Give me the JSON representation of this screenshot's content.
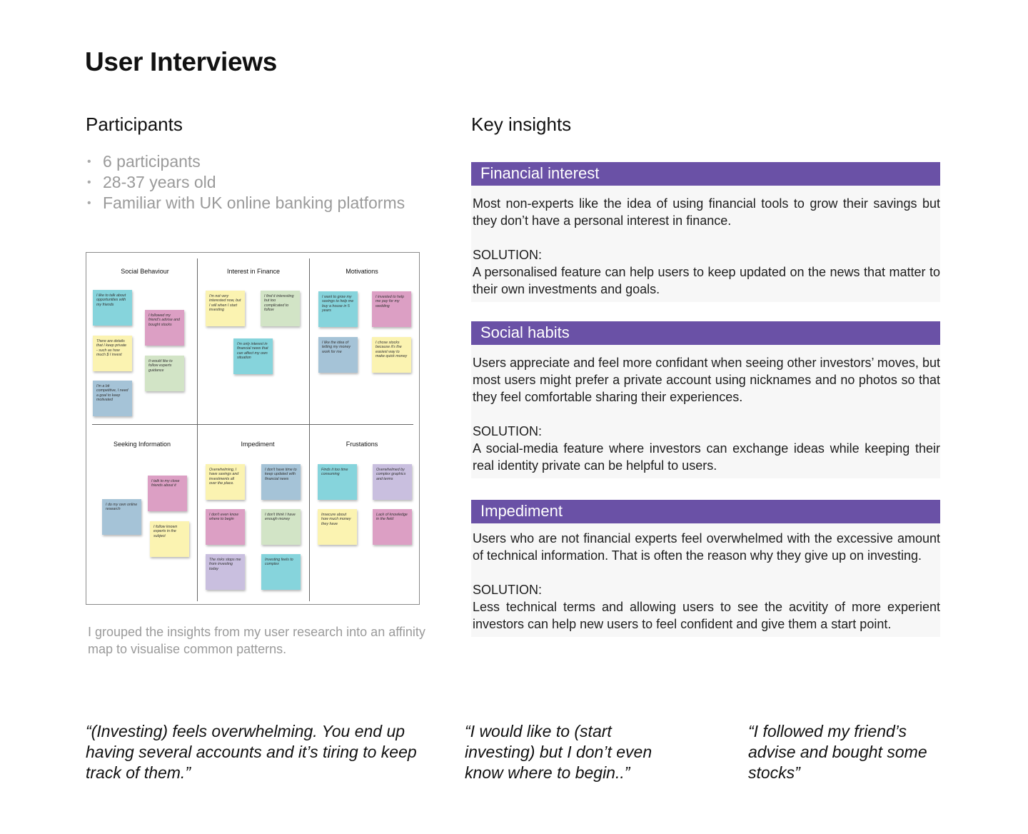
{
  "title": "User Interviews",
  "participants": {
    "heading": "Participants",
    "items": [
      "6 participants",
      "28-37 years old",
      "Familiar with UK online banking platforms"
    ]
  },
  "affinity_map": {
    "columns": [
      "Social Behaviour",
      "Interest in Finance",
      "Motivations",
      "Seeking Information",
      "Impediment",
      "Frustations"
    ],
    "notes": [
      {
        "text": "I like to talk about opportunities with my friends",
        "color": "cyan"
      },
      {
        "text": "I followed my friend's advise and bought stocks",
        "color": "pink"
      },
      {
        "text": "There are details that I keep private - such as how much $ I invest",
        "color": "yellow"
      },
      {
        "text": "It would like to follow experts guidance",
        "color": "green"
      },
      {
        "text": "I'm a bit competitive, I need a goal to keep motivated",
        "color": "blue"
      },
      {
        "text": "I'm not very interested now, but I will when I start investing",
        "color": "yellow"
      },
      {
        "text": "I find it interesting but too complicated to follow",
        "color": "green"
      },
      {
        "text": "I'm only interest in financial news that can affect my own situation",
        "color": "cyan"
      },
      {
        "text": "I want to grow my savings to help me buy a house in 5 years",
        "color": "cyan"
      },
      {
        "text": "I invested to help me pay for my wedding",
        "color": "pink"
      },
      {
        "text": "I like the idea of letting my money work for me",
        "color": "blue"
      },
      {
        "text": "I chose stocks because it's the easiest way to make quick money",
        "color": "yellow"
      },
      {
        "text": "I talk to my close friends about it",
        "color": "pink"
      },
      {
        "text": "I do my own online research",
        "color": "blue"
      },
      {
        "text": "I follow known experts in the subject",
        "color": "yellow"
      },
      {
        "text": "Overwhelming, I have savings and investments all over the place.",
        "color": "yellow"
      },
      {
        "text": "I don't have time to keep updated with financial news",
        "color": "blue"
      },
      {
        "text": "I don't even know where to begin",
        "color": "pink"
      },
      {
        "text": "I don't think I have enough money",
        "color": "green"
      },
      {
        "text": "The risks stops me from investing today",
        "color": "lavender"
      },
      {
        "text": "Investing feels to complex",
        "color": "cyan"
      },
      {
        "text": "Finds it too time consuming",
        "color": "cyan"
      },
      {
        "text": "Overwhelmed by complex graphics and terms",
        "color": "lavender"
      },
      {
        "text": "Insecure about how much money they have",
        "color": "yellow"
      },
      {
        "text": "Lack of knowledge in the field",
        "color": "pink"
      }
    ],
    "caption": "I grouped the insights from my user research into an affinity map to visualise common patterns."
  },
  "insights": {
    "heading": "Key insights",
    "solution_label": "SOLUTION:",
    "blocks": [
      {
        "title": "Financial interest",
        "body": "Most non-experts like the idea of using financial tools to grow their savings but they don’t have a personal interest in finance.",
        "solution": "A personalised feature can help users to keep updated on the news that matter to their own investments and goals."
      },
      {
        "title": "Social habits",
        "body": "Users appreciate and feel more confidant when seeing other investors’ moves, but most users might prefer a private account using nicknames and no photos so that they feel comfortable sharing their experiences.",
        "solution": "A social-media feature where investors can exchange ideas while keeping their real identity private can be helpful to users."
      },
      {
        "title": "Impediment",
        "body": "Users who are not financial experts feel overwhelmed with the excessive amount of technical information. That is often the reason why they give up on investing.",
        "solution": "Less technical terms and allowing users to see the acvitity of more experient investors can help new users to feel confident and give them a start point."
      }
    ]
  },
  "quotes": [
    "“(Investing) feels overwhelming. You end up having several accounts and it’s tiring to keep track of them.”",
    "“I would like to (start investing) but I don’t even know where to begin..”",
    "“I followed my friend’s advise and bought some stocks”"
  ],
  "colors": {
    "accent": "#6a51a6",
    "muted_text": "#9a9a9a",
    "insight_bg": "#f7f7f7"
  }
}
